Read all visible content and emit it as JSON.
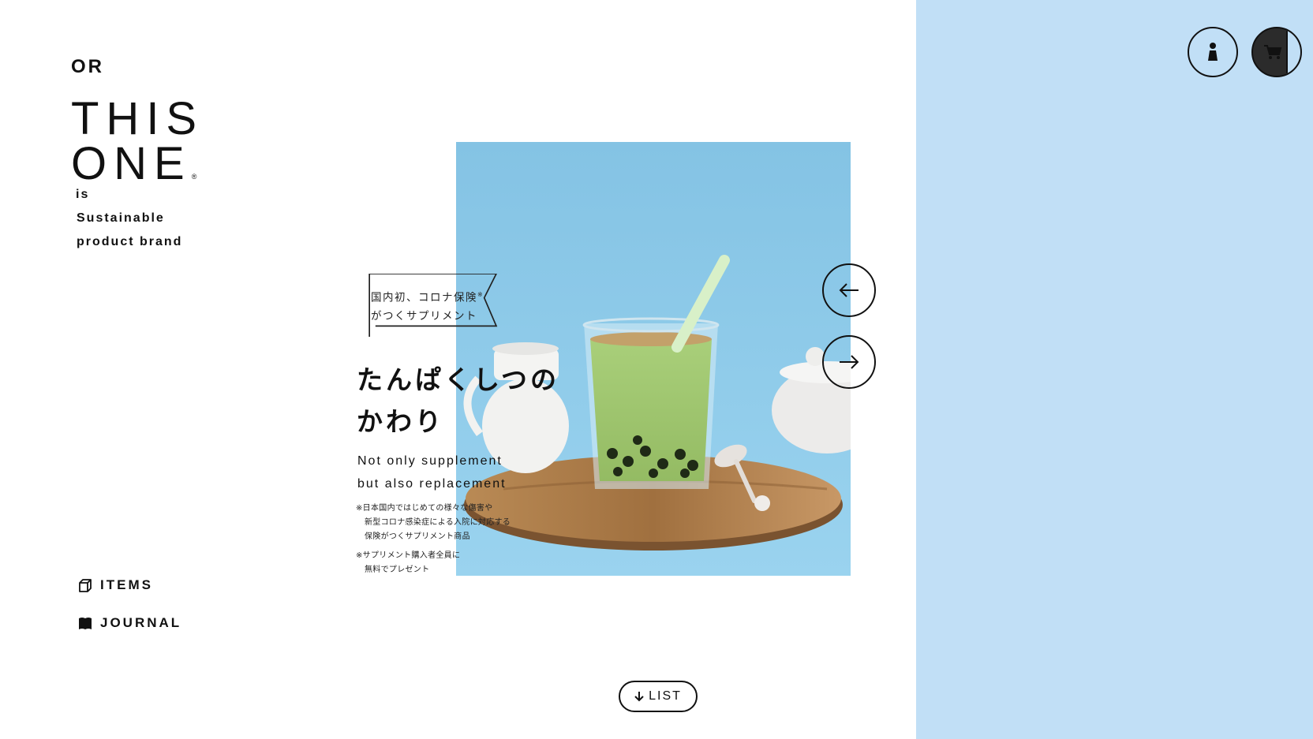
{
  "brand": {
    "or": "OR",
    "name_line1": "THIS",
    "name_line2": "ONE",
    "registered": "®",
    "tagline": [
      "is",
      "Sustainable",
      "product brand"
    ]
  },
  "nav": {
    "items": [
      {
        "label": "ITEMS",
        "icon": "box-icon"
      },
      {
        "label": "JOURNAL",
        "icon": "book-icon"
      }
    ]
  },
  "header": {
    "user_icon": "user-icon",
    "cart_icon": "cart-icon"
  },
  "hero": {
    "badge_line1": "国内初、コロナ保険",
    "badge_mark": "※",
    "badge_line2": "がつくサプリメント",
    "headline_line1": "たんぱくしつの",
    "headline_line2": "かわり",
    "sub_line1": "Not only supplement",
    "sub_line2": "but also replacement",
    "note1_line1": "※日本国内ではじめての様々な傷害や",
    "note1_line2": "新型コロナ感染症による入院に対応する",
    "note1_line3": "保険がつくサプリメント商品",
    "note2_line1": "※サプリメント購入者全員に",
    "note2_line2": "無料でプレゼント"
  },
  "list_button": {
    "label": "LIST"
  },
  "colors": {
    "panel": "#c1dff6",
    "hero_bg": "#8fcaea",
    "drink": "#9cc46e"
  }
}
